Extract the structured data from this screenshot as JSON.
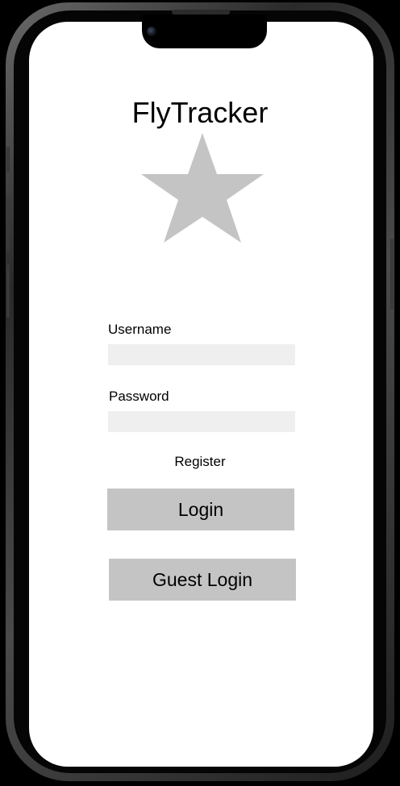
{
  "app": {
    "title": "FlyTracker",
    "logo_icon": "star-icon",
    "logo_color": "#c4c4c4"
  },
  "form": {
    "username": {
      "label": "Username",
      "value": "",
      "placeholder": ""
    },
    "password": {
      "label": "Password",
      "value": "",
      "placeholder": ""
    },
    "register_label": "Register",
    "login_label": "Login",
    "guest_login_label": "Guest Login",
    "field_color": "#efefef",
    "button_color": "#c4c4c4"
  }
}
